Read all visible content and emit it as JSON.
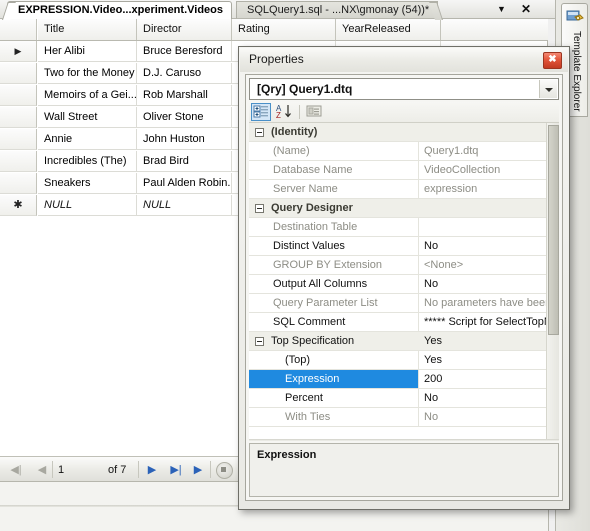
{
  "tabs": {
    "active": "EXPRESSION.Video...xperiment.Videos",
    "inactive": "SQLQuery1.sql - ...NX\\gmonay (54))*",
    "dropdown_icon": "chevron-down-icon",
    "close_icon": "close-icon"
  },
  "grid": {
    "columns": [
      "Title",
      "Director",
      "Rating",
      "YearReleased"
    ],
    "rows": [
      {
        "marker": "▶",
        "Title": "Her Alibi",
        "Director": "Bruce Beresford",
        "Rating": "",
        "YearReleased": ""
      },
      {
        "marker": "",
        "Title": "Two for the Money",
        "Director": "D.J. Caruso",
        "Rating": "",
        "YearReleased": ""
      },
      {
        "marker": "",
        "Title": "Memoirs of a Gei...",
        "Director": "Rob Marshall",
        "Rating": "",
        "YearReleased": ""
      },
      {
        "marker": "",
        "Title": "Wall Street",
        "Director": "Oliver Stone",
        "Rating": "",
        "YearReleased": ""
      },
      {
        "marker": "",
        "Title": "Annie",
        "Director": "John Huston",
        "Rating": "",
        "YearReleased": ""
      },
      {
        "marker": "",
        "Title": "Incredibles (The)",
        "Director": "Brad Bird",
        "Rating": "",
        "YearReleased": ""
      },
      {
        "marker": "",
        "Title": "Sneakers",
        "Director": "Paul Alden Robin...",
        "Rating": "",
        "YearReleased": ""
      },
      {
        "marker": "✱",
        "Title": "NULL",
        "Director": "NULL",
        "Rating": "",
        "YearReleased": ""
      }
    ]
  },
  "navigation": {
    "first_label": "◀|",
    "prev_label": "◀",
    "current_row": "1",
    "of_label": "of 7",
    "next_label": "▶",
    "last_label": "▶|",
    "new_label": "▶",
    "stop_label": "stop-icon"
  },
  "right_dock": {
    "tab_label": "Template Explorer",
    "icon": "template-explorer-icon"
  },
  "dialog": {
    "title": "Properties",
    "close_icon": "close-icon",
    "object_combo": {
      "value": "[Qry] Query1.dtq",
      "arrow_icon": "chevron-down-icon"
    },
    "toolbar": {
      "categorized_icon": "categorized-view-icon",
      "alphabetical_icon": "alphabetical-sort-icon",
      "property_pages_icon": "property-pages-icon"
    },
    "properties": [
      {
        "kind": "category",
        "name": "(Identity)",
        "value": "",
        "dim": false,
        "selected": false,
        "sub": false
      },
      {
        "kind": "item",
        "name": "(Name)",
        "value": "Query1.dtq",
        "dim": true,
        "selected": false,
        "sub": false
      },
      {
        "kind": "item",
        "name": "Database Name",
        "value": "VideoCollection",
        "dim": true,
        "selected": false,
        "sub": false
      },
      {
        "kind": "item",
        "name": "Server Name",
        "value": "expression",
        "dim": true,
        "selected": false,
        "sub": false
      },
      {
        "kind": "category",
        "name": "Query Designer",
        "value": "",
        "dim": false,
        "selected": false,
        "sub": false
      },
      {
        "kind": "item",
        "name": "Destination Table",
        "value": "",
        "dim": true,
        "selected": false,
        "sub": false
      },
      {
        "kind": "item",
        "name": "Distinct Values",
        "value": "No",
        "dim": false,
        "selected": false,
        "sub": false
      },
      {
        "kind": "item",
        "name": "GROUP BY Extension",
        "value": "<None>",
        "dim": true,
        "selected": false,
        "sub": false
      },
      {
        "kind": "item",
        "name": "Output All Columns",
        "value": "No",
        "dim": false,
        "selected": false,
        "sub": false
      },
      {
        "kind": "item",
        "name": "Query Parameter List",
        "value": "No parameters have been specified",
        "dim": true,
        "selected": false,
        "sub": false
      },
      {
        "kind": "item",
        "name": "SQL Comment",
        "value": "***** Script for SelectTopNRows co",
        "dim": false,
        "selected": false,
        "sub": false
      },
      {
        "kind": "category",
        "name": "Top Specification",
        "value": "Yes",
        "dim": false,
        "selected": false,
        "sub": false
      },
      {
        "kind": "item",
        "name": "(Top)",
        "value": "Yes",
        "dim": false,
        "selected": false,
        "sub": true
      },
      {
        "kind": "item",
        "name": "Expression",
        "value": "200",
        "dim": false,
        "selected": true,
        "sub": true
      },
      {
        "kind": "item",
        "name": "Percent",
        "value": "No",
        "dim": false,
        "selected": false,
        "sub": true
      },
      {
        "kind": "item",
        "name": "With Ties",
        "value": "No",
        "dim": true,
        "selected": false,
        "sub": true
      }
    ],
    "description": {
      "title": "Expression"
    }
  },
  "colors": {
    "selection_blue": "#1f8ae0",
    "close_red": "#e2553a",
    "nav_blue": "#2b62b8",
    "category_bg": "#efefe9"
  }
}
